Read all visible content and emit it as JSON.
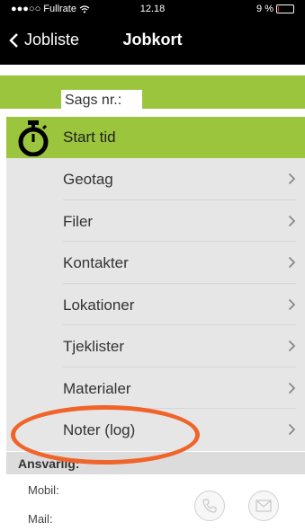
{
  "status_bar": {
    "carrier_dots": "●●●○○",
    "carrier": "Fullrate",
    "time": "12.18",
    "battery": "9 %",
    "battery_level": 0.09
  },
  "nav": {
    "back_label": "Jobliste",
    "title": "Jobkort"
  },
  "sags": {
    "label": "Sags nr.:"
  },
  "start": {
    "label": "Start tid"
  },
  "menu": {
    "items": [
      {
        "label": "Geotag"
      },
      {
        "label": "Filer"
      },
      {
        "label": "Kontakter"
      },
      {
        "label": "Lokationer"
      },
      {
        "label": "Tjeklister"
      },
      {
        "label": "Materialer"
      },
      {
        "label": "Noter (log)"
      }
    ]
  },
  "responsible": {
    "title": "Ansvarlig:",
    "mobile_label": "Mobil:",
    "mail_label": "Mail:"
  },
  "colors": {
    "accent_green": "#9bc53d",
    "highlight_orange": "#f0642a"
  },
  "icons": [
    "wifi-icon",
    "battery-icon",
    "back-chevron-icon",
    "stopwatch-icon",
    "chevron-right-icon",
    "phone-icon",
    "envelope-icon"
  ]
}
